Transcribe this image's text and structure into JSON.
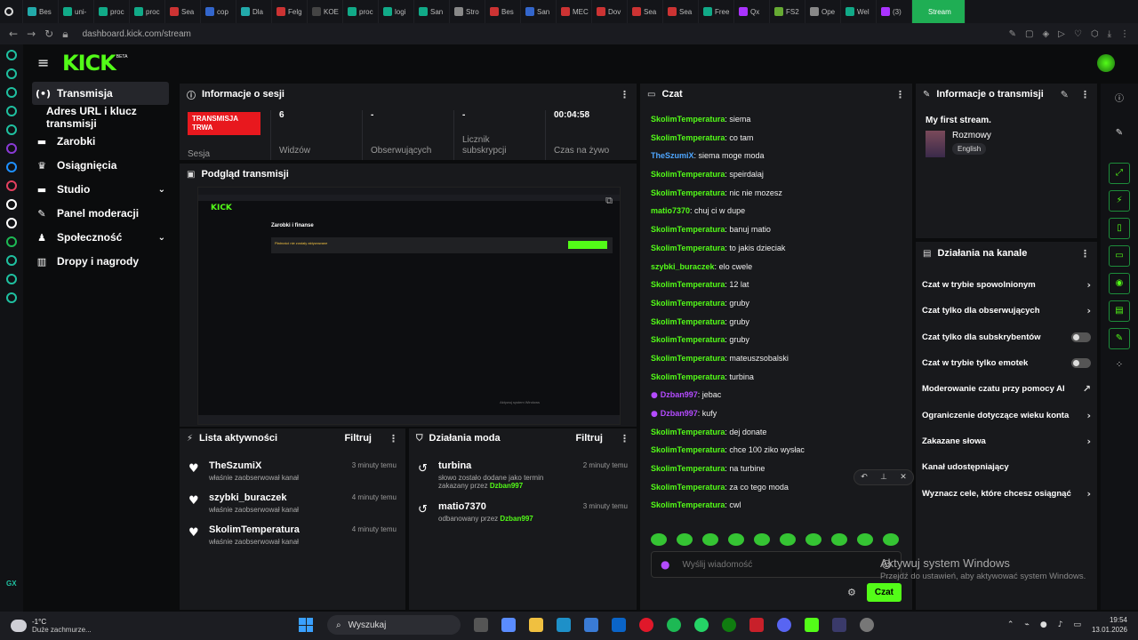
{
  "browser": {
    "tabs": [
      "Bes",
      "uni-",
      "proc",
      "proc",
      "Sea",
      "cop",
      "Dla",
      "Felg",
      "KOE",
      "proc",
      "logi",
      "San",
      "Stro",
      "Bes",
      "San",
      "MEC",
      "Dov",
      "Sea",
      "Sea",
      "Free",
      "Qx",
      "FS2",
      "Ope",
      "Wel",
      "(3)",
      "Stream"
    ],
    "url": "dashboard.kick.com/stream"
  },
  "app": {
    "logo": "KICK",
    "beta": "BETA"
  },
  "nav": {
    "items": [
      {
        "label": "Transmisja",
        "icon": "broadcast-icon"
      },
      {
        "label": "Adres URL i klucz transmisji",
        "icon": ""
      },
      {
        "label": "Zarobki",
        "icon": "dollar-icon"
      },
      {
        "label": "Osiągnięcia",
        "icon": "trophy-icon"
      },
      {
        "label": "Studio",
        "icon": "studio-icon"
      },
      {
        "label": "Panel moderacji",
        "icon": "wrench-icon"
      },
      {
        "label": "Społeczność",
        "icon": "community-icon"
      },
      {
        "label": "Dropy i nagrody",
        "icon": "chart-icon"
      }
    ]
  },
  "session": {
    "title": "Informacje o sesji",
    "live_badge": "TRANSMISJA TRWA",
    "live_label": "Sesja",
    "stats": [
      {
        "value": "6",
        "label": "Widzów"
      },
      {
        "value": "-",
        "label": "Obserwujących"
      },
      {
        "value": "-",
        "label": "Licznik subskrypcji"
      },
      {
        "value": "00:04:58",
        "label": "Czas na żywo"
      }
    ]
  },
  "preview": {
    "title": "Podgląd transmisji",
    "inner_title": "Zarobki i finanse",
    "inner_alert": "Płatności nie zostały aktywowane",
    "inner_watermark": "Aktywuj system Windows"
  },
  "activity": {
    "title": "Lista aktywności",
    "filter": "Filtruj",
    "items": [
      {
        "who": "TheSzumiX",
        "what": "właśnie zaobserwował kanał",
        "when": "3 minuty temu"
      },
      {
        "who": "szybki_buraczek",
        "what": "właśnie zaobserwował kanał",
        "when": "4 minuty temu"
      },
      {
        "who": "SkolimTemperatura",
        "what": "właśnie zaobserwował kanał",
        "when": "4 minuty temu"
      }
    ]
  },
  "modactions": {
    "title": "Działania moda",
    "filter": "Filtruj",
    "items": [
      {
        "who": "turbina",
        "what": "słowo zostało dodane jako termin zakazany przez",
        "by": "Dzban997",
        "when": "2 minuty temu"
      },
      {
        "who": "matio7370",
        "what": "odbanowany przez",
        "by": "Dzban997",
        "when": "3 minuty temu"
      }
    ]
  },
  "chat": {
    "title": "Czat",
    "messages": [
      {
        "user": "SkolimTemperatura",
        "color": "#53fc18",
        "text": "siema",
        "mic": false
      },
      {
        "user": "SkolimTemperatura",
        "color": "#53fc18",
        "text": "co tam",
        "mic": false
      },
      {
        "user": "TheSzumiX",
        "color": "#4ea6ff",
        "text": "siema moge moda",
        "mic": false
      },
      {
        "user": "SkolimTemperatura",
        "color": "#53fc18",
        "text": "speirdalaj",
        "mic": false
      },
      {
        "user": "SkolimTemperatura",
        "color": "#53fc18",
        "text": "nic nie mozesz",
        "mic": false
      },
      {
        "user": "matio7370",
        "color": "#53fc18",
        "text": "chuj ci w dupe",
        "mic": false
      },
      {
        "user": "SkolimTemperatura",
        "color": "#53fc18",
        "text": "banuj matio",
        "mic": false
      },
      {
        "user": "SkolimTemperatura",
        "color": "#53fc18",
        "text": "to jakis dzieciak",
        "mic": false
      },
      {
        "user": "szybki_buraczek",
        "color": "#53fc18",
        "text": "elo cwele",
        "mic": false
      },
      {
        "user": "SkolimTemperatura",
        "color": "#53fc18",
        "text": "12 lat",
        "mic": false
      },
      {
        "user": "SkolimTemperatura",
        "color": "#53fc18",
        "text": "gruby",
        "mic": false
      },
      {
        "user": "SkolimTemperatura",
        "color": "#53fc18",
        "text": "gruby",
        "mic": false
      },
      {
        "user": "SkolimTemperatura",
        "color": "#53fc18",
        "text": "gruby",
        "mic": false
      },
      {
        "user": "SkolimTemperatura",
        "color": "#53fc18",
        "text": "mateuszsobalski",
        "mic": false
      },
      {
        "user": "SkolimTemperatura",
        "color": "#53fc18",
        "text": "turbina",
        "mic": false
      },
      {
        "user": "Dzban997",
        "color": "#b44bff",
        "text": "jebac",
        "mic": true
      },
      {
        "user": "Dzban997",
        "color": "#b44bff",
        "text": "kufy",
        "mic": true
      },
      {
        "user": "SkolimTemperatura",
        "color": "#53fc18",
        "text": "dej donate",
        "mic": false
      },
      {
        "user": "SkolimTemperatura",
        "color": "#53fc18",
        "text": "chce 100 ziko wysłac",
        "mic": false
      },
      {
        "user": "SkolimTemperatura",
        "color": "#53fc18",
        "text": "na turbine",
        "mic": false
      },
      {
        "user": "SkolimTemperatura",
        "color": "#53fc18",
        "text": "za co tego moda",
        "mic": false
      },
      {
        "user": "SkolimTemperatura",
        "color": "#53fc18",
        "text": "cwl",
        "mic": false
      }
    ],
    "placeholder": "Wyślij wiadomość",
    "send": "Czat"
  },
  "streaminfo": {
    "title": "Informacje o transmisji",
    "stream_title": "My first stream.",
    "category": "Rozmowy",
    "language": "English"
  },
  "channel": {
    "title": "Działania na kanale",
    "items": [
      {
        "label": "Czat w trybie spowolnionym",
        "ctl": "arrow"
      },
      {
        "label": "Czat tylko dla obserwujących",
        "ctl": "arrow"
      },
      {
        "label": "Czat tylko dla subskrybentów",
        "ctl": "toggle"
      },
      {
        "label": "Czat w trybie tylko emotek",
        "ctl": "toggle"
      },
      {
        "label": "Moderowanie czatu przy pomocy AI",
        "ctl": "ext"
      },
      {
        "label": "Ograniczenie dotyczące wieku konta",
        "ctl": "arrow"
      },
      {
        "label": "Zakazane słowa",
        "ctl": "arrow"
      },
      {
        "label": "Kanał udostępniający",
        "ctl": "none"
      },
      {
        "label": "Wyznacz cele, które chcesz osiągnąć",
        "ctl": "arrow"
      }
    ]
  },
  "watermark": {
    "line1": "Aktywuj system Windows",
    "line2": "Przejdź do ustawień, aby aktywować system Windows."
  },
  "taskbar": {
    "temp": "-1°C",
    "weather": "Duże zachmurze...",
    "search": "Wyszukaj",
    "time": "19:54",
    "date": "13.01.2026"
  },
  "colors": {
    "accent": "#53fc18",
    "live": "#e8181e",
    "mic": "#b44bff"
  }
}
